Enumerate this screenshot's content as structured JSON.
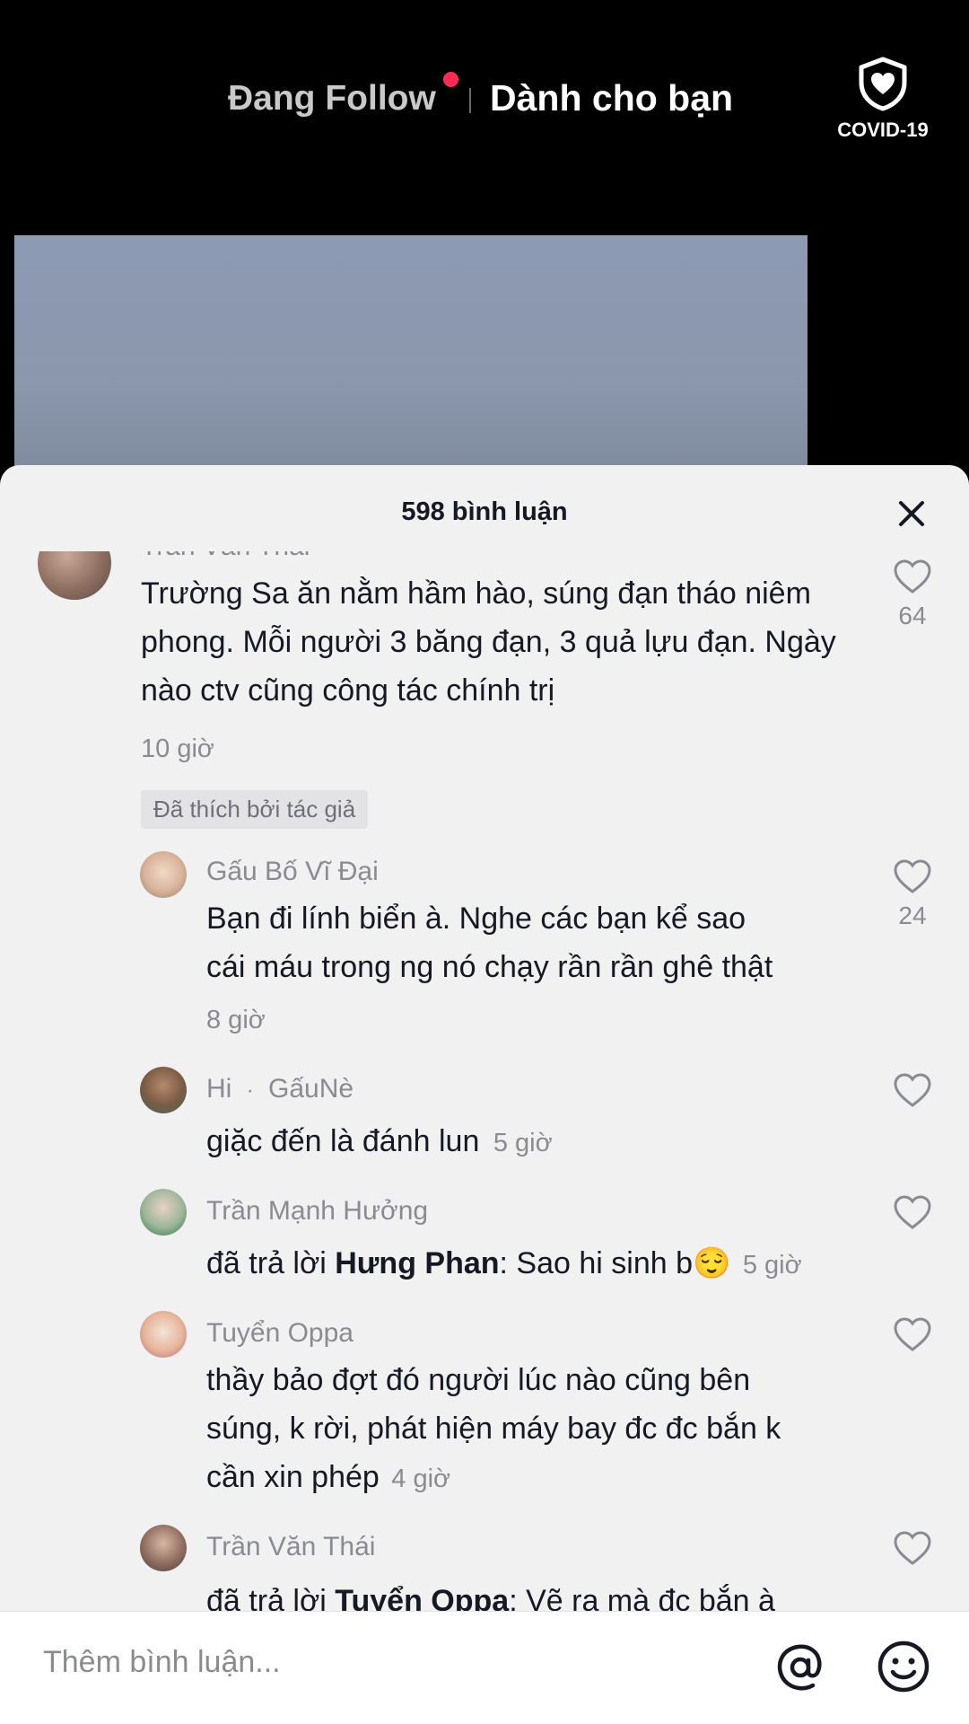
{
  "top_nav": {
    "following": "Đang Follow",
    "for_you": "Dành cho bạn",
    "covid_label": "COVID-19",
    "following_dot_color": "#fe2c55"
  },
  "comments_panel": {
    "title": "598 bình luận",
    "input_placeholder": "Thêm bình luận...",
    "icons": [
      "close-icon",
      "heart-icon",
      "at-icon",
      "smile-icon"
    ]
  },
  "comments": [
    {
      "username": "Trần Văn Thái",
      "text": "Trường Sa ăn nằm hầm hào, súng đạn tháo niêm phong. Mỗi người 3 băng đạn, 3 quả lựu đạn. Ngày nào ctv cũng công tác chính trị",
      "time": "10 giờ",
      "likes": "64",
      "badge": "Đã thích bởi tác giả"
    },
    {
      "username": "Gấu Bố Vĩ Đại",
      "text_line1": "Bạn đi lính biển à. Nghe các bạn kể sao",
      "text_line2": "cái máu trong ng nó chạy rần rần ghê thật",
      "time": "8 giờ",
      "likes": "24"
    },
    {
      "username_part1": "Hi",
      "username_sep": "·",
      "username_part2": "GấuNè",
      "text": "giặc đến là đánh lun",
      "time": "5 giờ"
    },
    {
      "username": "Trần Mạnh Hưởng",
      "reply_prefix": "đã trả lời",
      "reply_to": "Hưng Phan",
      "text": ": Sao hi sinh b",
      "emoji": "😌",
      "time": "5 giờ"
    },
    {
      "username": "Tuyển Oppa",
      "text_line1": "thầy bảo đợt đó người lúc nào cũng bên",
      "text_line2": "súng, k rời, phát hiện máy bay đc đc bắn k",
      "text_line3": "cần xin phép",
      "time": "4 giờ"
    },
    {
      "username": "Trần Văn Thái",
      "reply_prefix": "đã trả lời",
      "reply_to": "Tuyển Oppa",
      "text": ": Vẽ ra mà đc bắn à"
    }
  ]
}
